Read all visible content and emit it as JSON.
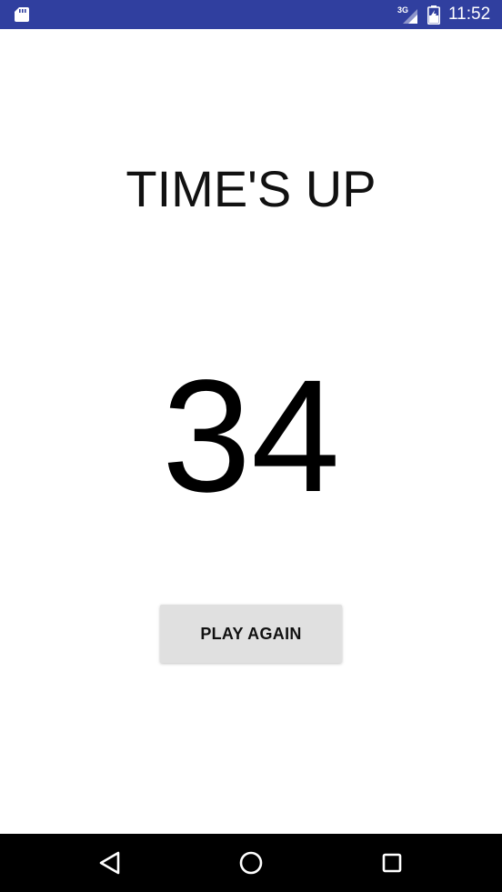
{
  "status_bar": {
    "time": "11:52",
    "network_label": "3G",
    "background_color": "#303f9f",
    "icons": [
      "sd-card-icon",
      "signal-icon",
      "battery-icon"
    ]
  },
  "main": {
    "title": "TIME'S UP",
    "score": "34",
    "play_again_label": "PLAY AGAIN"
  },
  "nav_bar": {
    "icons": [
      "back-icon",
      "home-icon",
      "recents-icon"
    ]
  }
}
